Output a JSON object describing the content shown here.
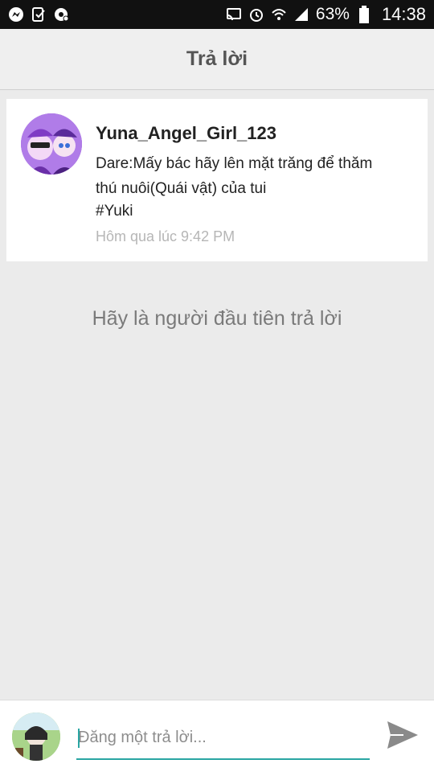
{
  "status_bar": {
    "battery_percent": "63%",
    "time": "14:38",
    "left_icons": [
      "messenger-icon",
      "notification-check-icon",
      "chrome-like-icon"
    ],
    "right_icons": [
      "cast-icon",
      "alarm-icon",
      "wifi-icon",
      "signal-icon",
      "battery-icon"
    ]
  },
  "header": {
    "title": "Trả lời"
  },
  "post": {
    "author": "Yuna_Angel_Girl_123",
    "body_line1": "Dare:Mấy bác hãy lên mặt trăng để thăm",
    "body_line2": "thú nuôi(Quái vật) của tui",
    "tag": "#Yuki",
    "timestamp": "Hôm qua lúc 9:42 PM"
  },
  "empty_state": {
    "text": "Hãy là người đầu tiên trả lời"
  },
  "reply": {
    "placeholder": "Đăng một trả lời...",
    "value": ""
  },
  "colors": {
    "accent": "#2aa6a3",
    "background": "#ebebeb",
    "card": "#ffffff",
    "status_bar": "#111111"
  }
}
